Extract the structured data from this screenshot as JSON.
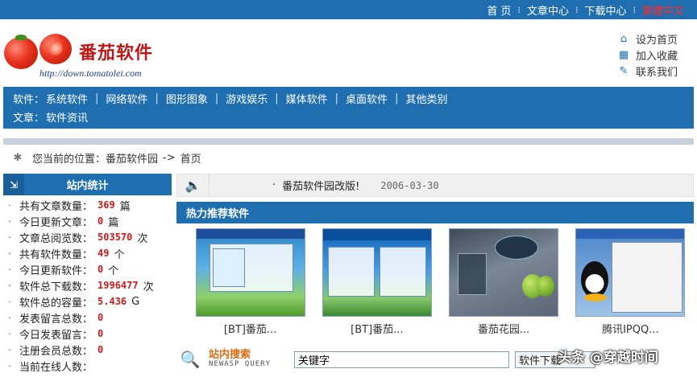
{
  "topnav": {
    "items": [
      {
        "label": "首 页"
      },
      {
        "label": "文章中心"
      },
      {
        "label": "下载中心"
      },
      {
        "label": "繁體中文"
      }
    ]
  },
  "header": {
    "logo_title": "番茄软件",
    "logo_url": "http://down.tomatolei.com",
    "quicklinks": [
      {
        "label": "设为首页",
        "icon": "home-icon"
      },
      {
        "label": "加入收藏",
        "icon": "gift-icon"
      },
      {
        "label": "联系我们",
        "icon": "edit-icon"
      }
    ]
  },
  "catnav": {
    "software_label": "软件：",
    "software_items": [
      "系统软件",
      "网络软件",
      "图形图象",
      "游戏娱乐",
      "媒体软件",
      "桌面软件",
      "其他类别"
    ],
    "article_label": "文章：",
    "article_items": [
      "软件资讯"
    ]
  },
  "breadcrumb": {
    "prefix": "您当前的位置：",
    "site": "番茄软件园",
    "arrow": "->",
    "current": "首页"
  },
  "stats": {
    "title": "站内统计",
    "rows": [
      {
        "label": "共有文章数量：",
        "value": "369",
        "unit": "篇"
      },
      {
        "label": "今日更新文章：",
        "value": "0",
        "unit": "篇"
      },
      {
        "label": "文章总阅览数：",
        "value": "503570",
        "unit": "次"
      },
      {
        "label": "共有软件数量：",
        "value": "49",
        "unit": "个"
      },
      {
        "label": "今日更新软件：",
        "value": "0",
        "unit": "个"
      },
      {
        "label": "软件总下载数：",
        "value": "1996477",
        "unit": "次"
      },
      {
        "label": "软件总的容量：",
        "value": "5.436",
        "unit": "G"
      },
      {
        "label": "发表留言总数：",
        "value": "0",
        "unit": ""
      },
      {
        "label": "今日发表留言：",
        "value": "0",
        "unit": ""
      },
      {
        "label": "注册会员总数：",
        "value": "0",
        "unit": ""
      },
      {
        "label": "当前在线人数：",
        "value": "",
        "unit": ""
      }
    ]
  },
  "notice": {
    "bullet": "·",
    "title": "番茄软件园改版!",
    "date": "2006-03-30"
  },
  "hot": {
    "title": "热力推荐软件",
    "items": [
      {
        "caption": "[BT]番茄..."
      },
      {
        "caption": "[BT]番茄..."
      },
      {
        "caption": "番茄花园..."
      },
      {
        "caption": "腾讯IPQQ..."
      }
    ]
  },
  "search": {
    "title": "站内搜索",
    "subtitle": "NEWASP QUERY",
    "input_value": "关键字",
    "select_value": "软件下载"
  },
  "watermark": "头条 @穿越时间",
  "colors": {
    "primary": "#1f6fb0",
    "value_red": "#d11a1a",
    "active_red": "#ff2a2a",
    "search_orange": "#e06a10"
  }
}
